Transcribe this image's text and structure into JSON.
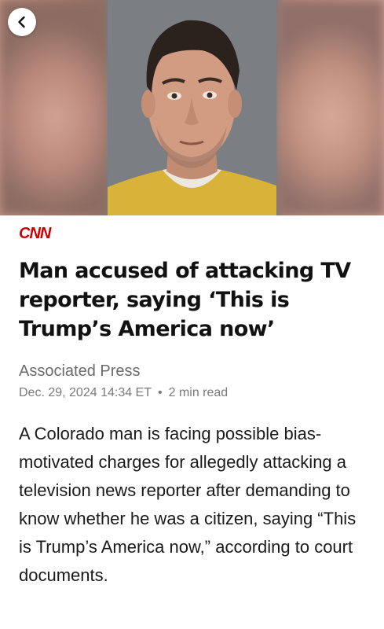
{
  "hero": {
    "image_alt": "Mugshot of a man in a yellow jumpsuit"
  },
  "nav": {
    "back_icon": "chevron-left-icon"
  },
  "article": {
    "source": "CNN",
    "headline": "Man accused of attacking TV reporter, saying ‘This is Trump’s America now’",
    "author": "Associated Press",
    "date": "Dec. 29, 2024 14:34 ET",
    "separator": "•",
    "read_time": "2 min read",
    "body": "A Colorado man is facing possible bias-motivated charges for allegedly attacking a television news reporter after demanding to know whether he was a citizen, saying “This is Trump’s America now,” according to court documents."
  },
  "colors": {
    "source_brand": "#cc0000",
    "headline": "#111111",
    "meta": "#7a7a7a"
  }
}
